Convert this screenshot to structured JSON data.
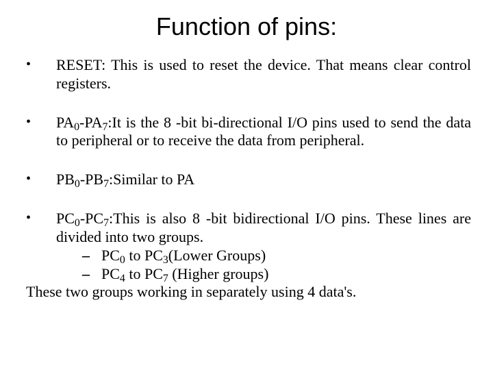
{
  "title": "Function of pins:",
  "bullets": [
    {
      "marker": "•",
      "runs": [
        {
          "t": "RESET: This is used to reset the device. That means clear control registers."
        }
      ]
    },
    {
      "marker": "•",
      "runs": [
        {
          "t": "PA"
        },
        {
          "t": "0",
          "sub": true
        },
        {
          "t": "-PA"
        },
        {
          "t": "7",
          "sub": true
        },
        {
          "t": ":It is the 8 -bit bi-directional I/O pins used to send the data to peripheral or to receive the data from peripheral."
        }
      ]
    },
    {
      "marker": "•",
      "runs": [
        {
          "t": "PB"
        },
        {
          "t": "0",
          "sub": true
        },
        {
          "t": "-PB"
        },
        {
          "t": "7",
          "sub": true
        },
        {
          "t": ":Similar to PA"
        }
      ]
    },
    {
      "marker": "•",
      "runs": [
        {
          "t": "PC"
        },
        {
          "t": "0",
          "sub": true
        },
        {
          "t": "-PC"
        },
        {
          "t": "7",
          "sub": true
        },
        {
          "t": ":This is also 8 -bit bidirectional I/O pins. These lines are divided into two groups."
        }
      ],
      "sublist": [
        {
          "dash": "–",
          "runs": [
            {
              "t": "PC"
            },
            {
              "t": "0",
              "sub": true
            },
            {
              "t": " to PC"
            },
            {
              "t": "3",
              "sub": true
            },
            {
              "t": "(Lower Groups)"
            }
          ]
        },
        {
          "dash": "–",
          "runs": [
            {
              "t": "PC"
            },
            {
              "t": "4",
              "sub": true
            },
            {
              "t": " to PC"
            },
            {
              "t": "7",
              "sub": true
            },
            {
              "t": " (Higher groups)"
            }
          ]
        }
      ],
      "trailer": "These two groups working in separately using 4 data's."
    }
  ]
}
